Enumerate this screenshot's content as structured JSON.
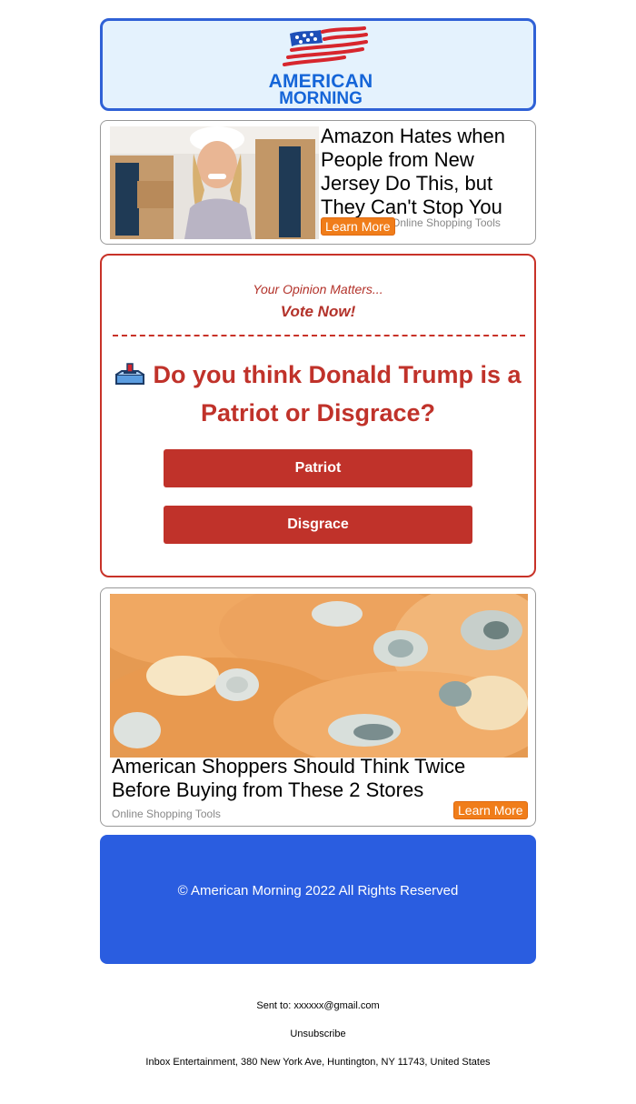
{
  "header": {
    "logo_line1": "AMERICAN",
    "logo_line2": "MORNING",
    "logo_blue": "#1565d8",
    "logo_red": "#d7262d"
  },
  "ad1": {
    "title": "Amazon Hates when People from New Jersey Do This, but They Can't Stop You",
    "source": "Online Shopping Tools",
    "button": "Learn More"
  },
  "poll": {
    "kicker": "Your Opinion Matters...",
    "cta": "Vote Now!",
    "question": "Do you think Donald Trump is a Patriot or Disgrace?",
    "icon": "ballot-box-icon",
    "options": [
      "Patriot",
      "Disgrace"
    ],
    "accent": "#c0322a"
  },
  "ad2": {
    "title": "American Shoppers Should Think Twice Before Buying from These 2 Stores",
    "source": "Online Shopping Tools",
    "button": "Learn More"
  },
  "footer": {
    "copyright": "© American Morning 2022 All Rights Reserved",
    "color": "#2a5de0",
    "sent_to": "Sent to: xxxxxx@gmail.com",
    "unsubscribe": "Unsubscribe",
    "address": "Inbox Entertainment, 380 New York Ave, Huntington, NY 11743, United States"
  }
}
